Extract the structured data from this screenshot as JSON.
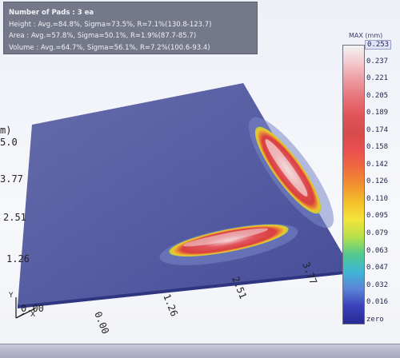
{
  "info": {
    "pad_count": "Number of Pads  : 3 ea",
    "height": "Height : Avg.=84.8%, Sigma=73.5%, R=7.1%(130.8-123.7)",
    "area": "Area : Avg.=57.8%, Sigma=50.1%, R=1.9%(87.7-85.7)",
    "volume": "Volume : Avg.=64.7%, Sigma=56.1%, R=7.2%(100.6-93.4)"
  },
  "colorbar": {
    "max_label": "MAX (mm)",
    "ticks": [
      "0.253",
      "0.237",
      "0.221",
      "0.205",
      "0.189",
      "0.174",
      "0.158",
      "0.142",
      "0.126",
      "0.110",
      "0.095",
      "0.079",
      "0.063",
      "0.047",
      "0.032",
      "0.016",
      "zero"
    ],
    "colors": [
      "#f2f2f2",
      "#f4c8cc",
      "#ec9aa0",
      "#e67378",
      "#e15558",
      "#d64b4b",
      "#e94f4f",
      "#ef6a3f",
      "#f09030",
      "#f4bf2a",
      "#f4e43a",
      "#b6e04a",
      "#53c98e",
      "#3fb6d6",
      "#5b84d8",
      "#3a40b9",
      "#282a95"
    ]
  },
  "axes": {
    "x_ticks": [
      "0.00",
      "1.26",
      "2.51",
      "3.77"
    ],
    "y_ticks": [
      "0.00",
      "1.26",
      "2.51",
      "3.77",
      "5.0"
    ],
    "y_unit_partial": "m)",
    "origin_x": "X",
    "origin_y": "Y"
  }
}
